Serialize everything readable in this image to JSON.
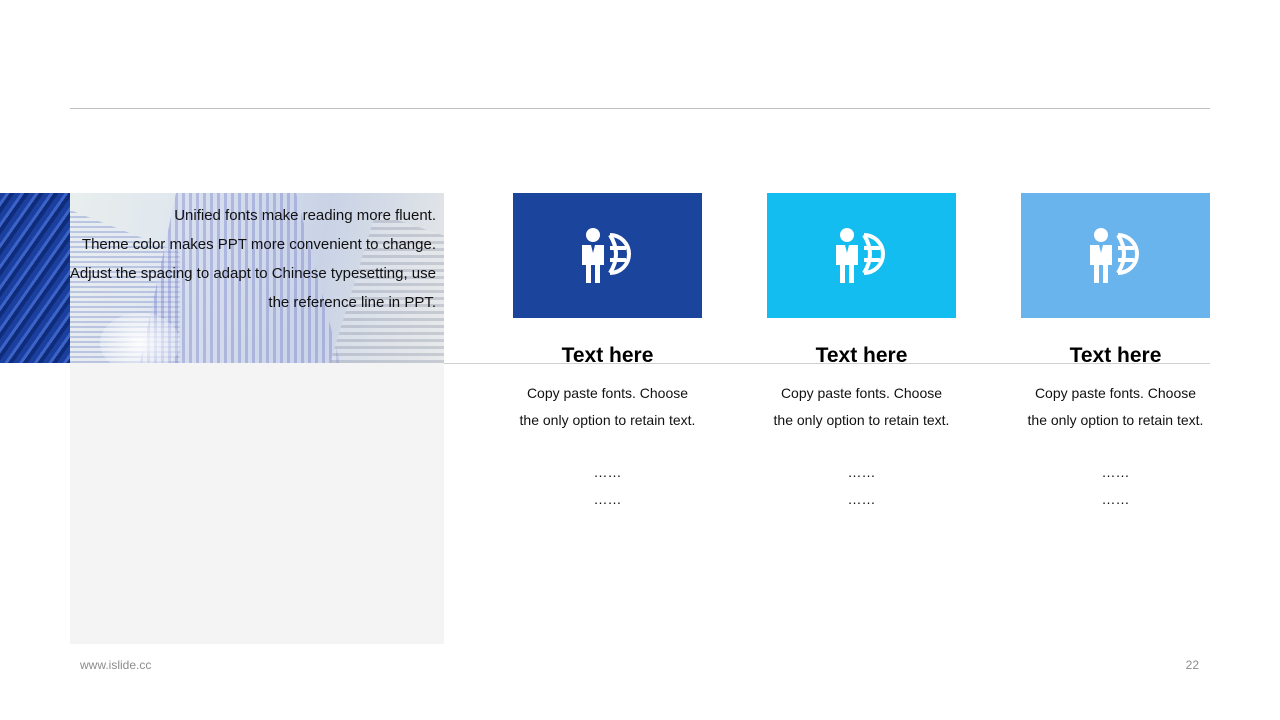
{
  "intro": {
    "lines": [
      "Unified fonts make reading more fluent.",
      "Theme color makes PPT more convenient to change.",
      "Adjust the spacing to adapt to Chinese typesetting, use the reference line in PPT."
    ]
  },
  "cards": [
    {
      "title": "Text here",
      "color": "#1b449c",
      "icon": "businessman-globe-icon",
      "description": "Copy paste fonts. Choose the only option to retain text.",
      "dots": [
        "……",
        "……"
      ]
    },
    {
      "title": "Text here",
      "color": "#13bdf0",
      "icon": "businessman-globe-icon",
      "description": "Copy paste fonts. Choose the only option to retain text.",
      "dots": [
        "……",
        "……"
      ]
    },
    {
      "title": "Text here",
      "color": "#69b4ec",
      "icon": "businessman-globe-icon",
      "description": "Copy paste fonts. Choose the only option to retain text.",
      "dots": [
        "……",
        "……"
      ]
    }
  ],
  "footer": {
    "website": "www.islide.cc",
    "page_number": "22"
  }
}
